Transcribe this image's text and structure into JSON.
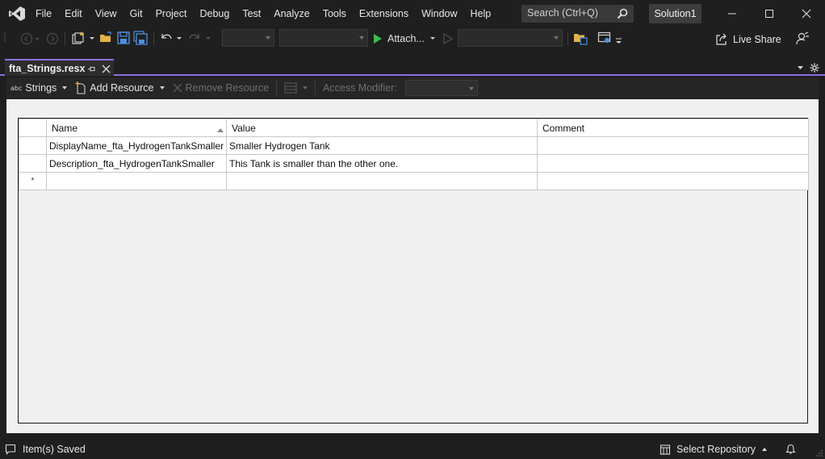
{
  "menu": [
    "File",
    "Edit",
    "View",
    "Git",
    "Project",
    "Debug",
    "Test",
    "Analyze",
    "Tools",
    "Extensions",
    "Window",
    "Help"
  ],
  "search": {
    "placeholder": "Search (Ctrl+Q)"
  },
  "solution_name": "Solution1",
  "toolbar": {
    "attach_label": "Attach...",
    "live_share_label": "Live Share"
  },
  "doc_tab": {
    "title": "fta_Strings.resx"
  },
  "resource_toolbar": {
    "strings_label": "Strings",
    "add_resource_label": "Add Resource",
    "remove_resource_label": "Remove Resource",
    "access_modifier_label": "Access Modifier:",
    "access_modifier_value": ""
  },
  "grid": {
    "columns": [
      "Name",
      "Value",
      "Comment"
    ],
    "rows": [
      {
        "name": "DisplayName_fta_HydrogenTankSmaller",
        "value": "Smaller Hydrogen Tank",
        "comment": ""
      },
      {
        "name": "Description_fta_HydrogenTankSmaller",
        "value": "This Tank is smaller than the other one.",
        "comment": ""
      }
    ],
    "new_row_marker": "*"
  },
  "status": {
    "message": "Item(s) Saved",
    "select_repository_label": "Select Repository"
  },
  "colors": {
    "accent": "#8c6fe0",
    "play_green": "#3fb950",
    "folder_yellow": "#e0b34a",
    "save_blue": "#4f8fe0"
  }
}
